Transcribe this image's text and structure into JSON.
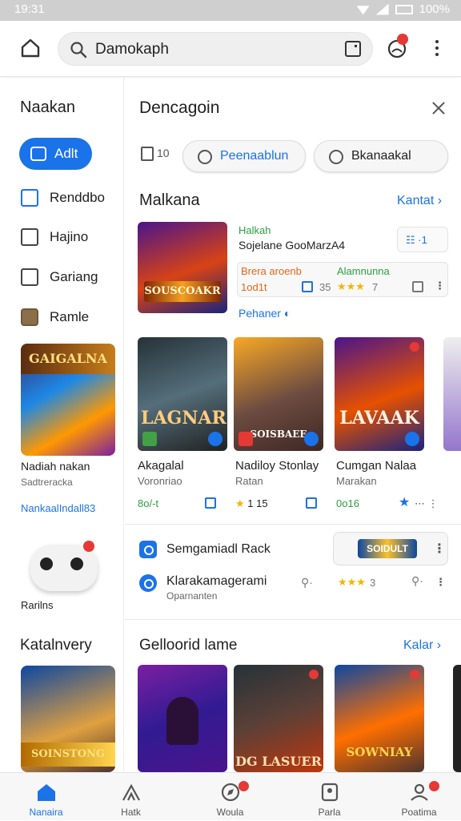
{
  "status": {
    "time": "19:31",
    "battery": "100%"
  },
  "search": {
    "query": "Damokaph"
  },
  "sidebar": {
    "title": "Naakan",
    "add_label": "Adlt",
    "items": [
      {
        "label": "Renddbo",
        "icon": "list-icon"
      },
      {
        "label": "Hajino",
        "icon": "book-icon"
      },
      {
        "label": "Gariang",
        "icon": "image-icon"
      },
      {
        "label": "Ramle",
        "icon": "avatar-icon"
      }
    ],
    "promo_logo": "GAIGALNA",
    "promo_name": "Nadiah nakan",
    "promo_sub": "Sadtreracka",
    "promo_link": "NankaalIndall83",
    "controller_label": "Rarilns",
    "section_title": "Katalnvery",
    "bottom_card_logo": "SOINSTONG"
  },
  "main": {
    "title": "Dencagoin",
    "filter_label": "10",
    "chips": [
      "Peenaablun",
      "Bkanaakal"
    ],
    "section1": {
      "title": "Malkana",
      "more": "Kantat"
    },
    "featured": {
      "logo": "SOUSCOAKR",
      "cat": "Halkah",
      "title": "Sojelane GooMarzA4",
      "label_a": "Brera aroenb",
      "label_b": "Alamnunna",
      "val_a": "1od1t",
      "count": "35",
      "rating": "7",
      "stars": 3,
      "link": "Pehaner"
    },
    "games": [
      {
        "logo": "LAGNAR",
        "title": "Akagalal",
        "sub": "Voronriao",
        "meta": "8o/-t"
      },
      {
        "logo": "SOISBAEE",
        "title": "Nadiloy Stonlay",
        "sub": "Ratan",
        "meta": "1 15"
      },
      {
        "logo": "LAVAAK",
        "title": "Cumgan Nalaa",
        "sub": "Marakan",
        "meta": "0o16"
      }
    ],
    "row1": {
      "title": "Semgamiadl Rack",
      "ad_logo": "SOIDULT"
    },
    "row2": {
      "title": "Klarakamagerami",
      "sub": "Oparnanten",
      "rating": "3",
      "stars": 3
    },
    "section2": {
      "title": "Gelloorid lame",
      "more": "Kalar"
    },
    "bottom_cards": [
      {
        "logo": ""
      },
      {
        "logo": "DG LASUER"
      },
      {
        "logo": "SOWNIAY"
      }
    ]
  },
  "bottomnav": [
    {
      "label": "Nanaira",
      "icon": "home-icon",
      "active": true
    },
    {
      "label": "Hatk",
      "icon": "tent-icon"
    },
    {
      "label": "Woula",
      "icon": "compass-icon"
    },
    {
      "label": "Parla",
      "icon": "bookmark-icon"
    },
    {
      "label": "Poatima",
      "icon": "profile-icon"
    }
  ]
}
